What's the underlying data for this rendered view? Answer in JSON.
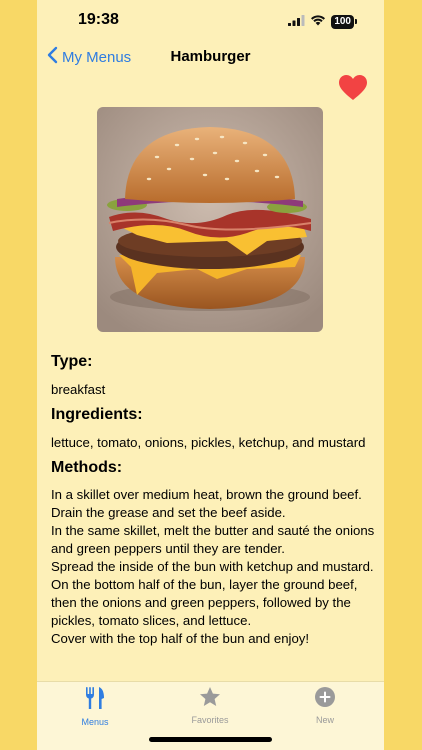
{
  "status": {
    "time": "19:38",
    "battery": "100"
  },
  "nav": {
    "back_label": "My Menus",
    "title": "Hamburger"
  },
  "recipe": {
    "favorite": true,
    "type_heading": "Type:",
    "type_value": "breakfast",
    "ingredients_heading": "Ingredients:",
    "ingredients_value": "lettuce, tomato, onions, pickles, ketchup, and mustard",
    "methods_heading": "Methods:",
    "methods": [
      "In a skillet over medium heat, brown the ground beef. Drain the grease and set the beef aside.",
      "In the same skillet, melt the butter and sauté the onions and green peppers until they are tender.",
      "Spread the inside of the bun with ketchup and mustard.",
      "On the bottom half of the bun, layer the ground beef, then the onions and green peppers, followed by the pickles, tomato slices, and lettuce.",
      "Cover with the top half of the bun and enjoy!"
    ]
  },
  "tabs": [
    {
      "label": "Menus",
      "icon": "fork-knife-icon",
      "active": true
    },
    {
      "label": "Favorites",
      "icon": "star-icon",
      "active": false
    },
    {
      "label": "New",
      "icon": "plus-circle-icon",
      "active": false
    }
  ],
  "colors": {
    "accent": "#2f7de1",
    "heart": "#f24343",
    "background": "#fdf0b8",
    "frame": "#f8d866",
    "inactive_tab": "#9a9a9a"
  }
}
